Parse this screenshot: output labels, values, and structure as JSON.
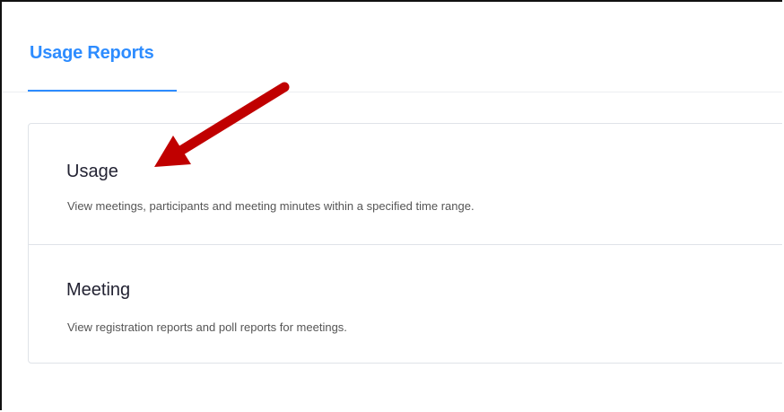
{
  "tabs": {
    "active_label": "Usage Reports"
  },
  "reports": [
    {
      "title": "Usage",
      "description": "View meetings, participants and meeting minutes within a specified time range."
    },
    {
      "title": "Meeting",
      "description": "View registration reports and poll reports for meetings."
    }
  ],
  "colors": {
    "accent": "#2d8cff",
    "title_text": "#232333",
    "description_text": "#555555",
    "border": "#dfe3e8",
    "annotation_arrow": "#c00000"
  },
  "annotation": {
    "arrow_icon": "red-arrow-icon",
    "points_to": "Usage"
  }
}
